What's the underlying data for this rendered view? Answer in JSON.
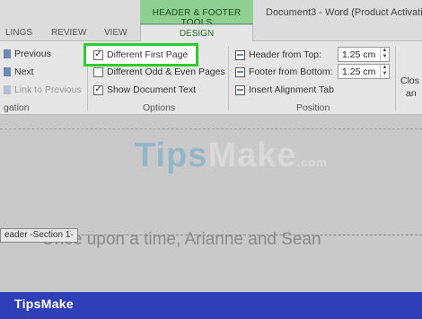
{
  "window": {
    "tool_group": "HEADER & FOOTER TOOLS",
    "title": "Document3 - Word (Product Activatio"
  },
  "tabs": [
    "LINGS",
    "REVIEW",
    "VIEW",
    "DESIGN"
  ],
  "navigation": {
    "previous": "Previous",
    "next": "Next",
    "link_to_previous": "Link to Previous",
    "group_label": "gation"
  },
  "options": {
    "different_first_page": {
      "label": "Different First Page",
      "checked": true
    },
    "different_odd_even": {
      "label": "Different Odd & Even Pages",
      "checked": false
    },
    "show_document_text": {
      "label": "Show Document Text",
      "checked": true
    },
    "group_label": "Options"
  },
  "position": {
    "header_from_top": {
      "label": "Header from Top:",
      "value": "1.25 cm"
    },
    "footer_from_bottom": {
      "label": "Footer from Bottom:",
      "value": "1.25 cm"
    },
    "insert_alignment_tab": "Insert Alignment Tab",
    "group_label": "Position"
  },
  "close": {
    "line1": "Clos",
    "line2": "an"
  },
  "document": {
    "header_tag": "eader -Section 1-",
    "body_text": "Once upon a time, Arianne and Sean"
  },
  "watermark": {
    "tips": "Tips",
    "make": "Make",
    "com": ".com"
  },
  "brand": "TipsMake",
  "colors": {
    "highlight": "#2ecc2e",
    "tool_group": "#8fcf92",
    "brand_band": "#2f3fb8"
  },
  "icons": [
    "previous-icon",
    "next-icon",
    "link-icon",
    "checkbox-icon",
    "spinner-icon",
    "alignment-tab-icon"
  ]
}
